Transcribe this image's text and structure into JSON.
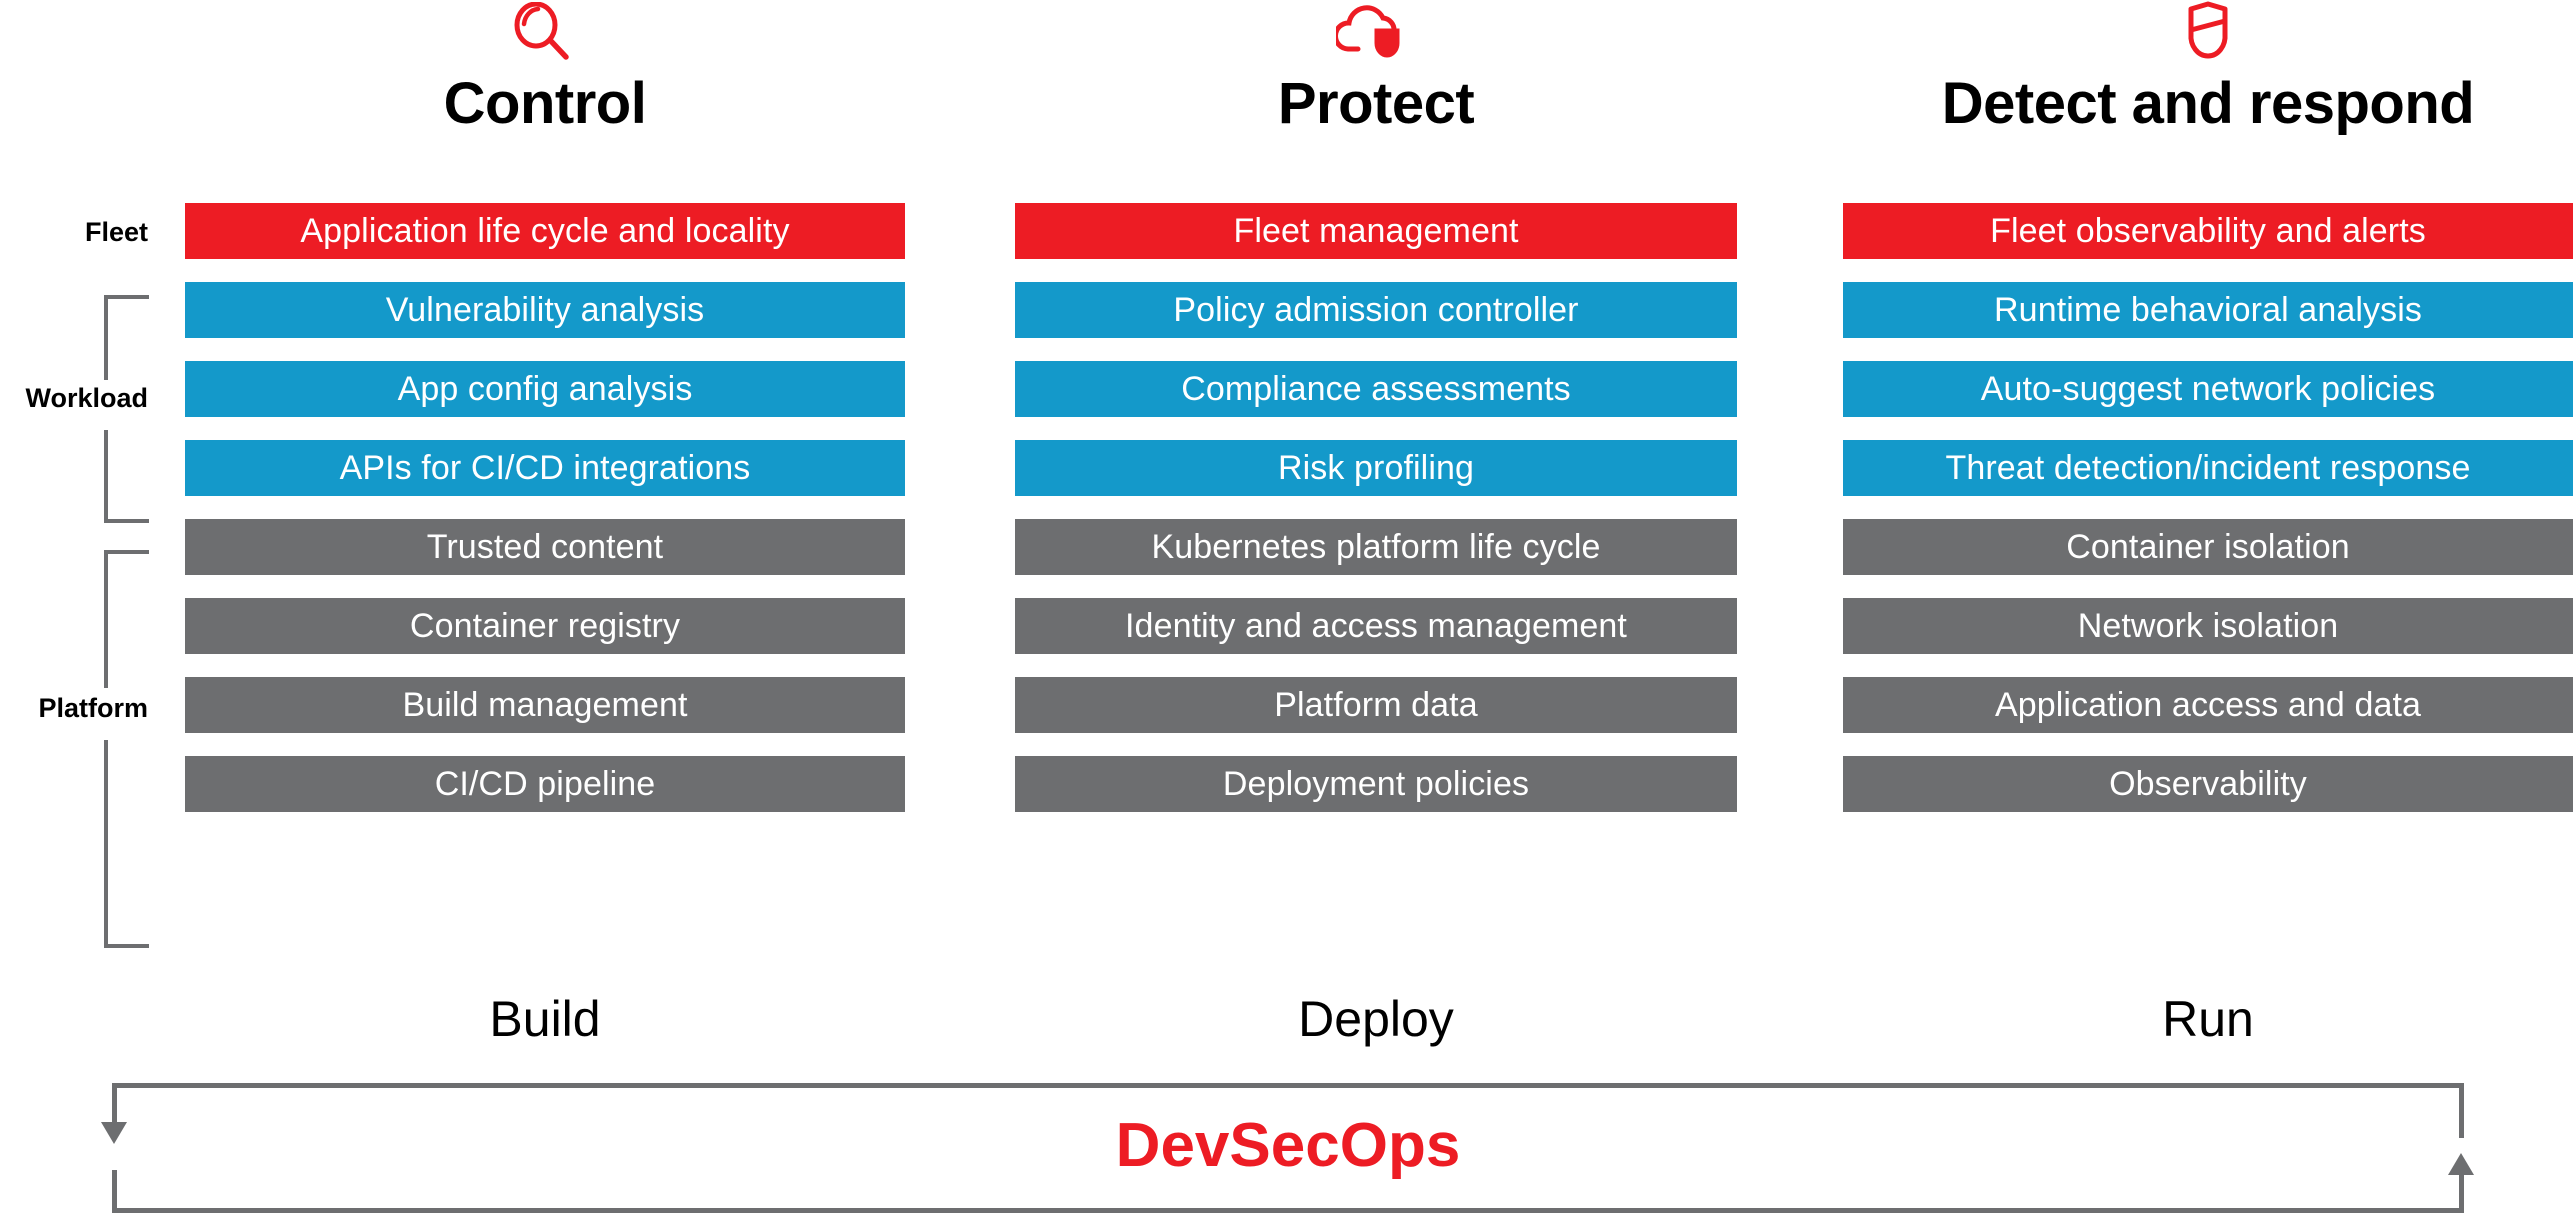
{
  "columns": [
    {
      "title": "Control",
      "icon": "magnifier-icon",
      "stage_label": "Build",
      "rows": [
        {
          "label": "Application life cycle and locality",
          "tier": "fleet"
        },
        {
          "label": "Vulnerability analysis",
          "tier": "workload"
        },
        {
          "label": "App config analysis",
          "tier": "workload"
        },
        {
          "label": "APIs for CI/CD integrations",
          "tier": "workload"
        },
        {
          "label": "Trusted content",
          "tier": "platform"
        },
        {
          "label": "Container registry",
          "tier": "platform"
        },
        {
          "label": "Build management",
          "tier": "platform"
        },
        {
          "label": "CI/CD pipeline",
          "tier": "platform"
        }
      ]
    },
    {
      "title": "Protect",
      "icon": "cloud-shield-icon",
      "stage_label": "Deploy",
      "rows": [
        {
          "label": "Fleet management",
          "tier": "fleet"
        },
        {
          "label": "Policy admission controller",
          "tier": "workload"
        },
        {
          "label": "Compliance assessments",
          "tier": "workload"
        },
        {
          "label": "Risk profiling",
          "tier": "workload"
        },
        {
          "label": "Kubernetes platform life cycle",
          "tier": "platform"
        },
        {
          "label": "Identity and access management",
          "tier": "platform"
        },
        {
          "label": "Platform data",
          "tier": "platform"
        },
        {
          "label": "Deployment policies",
          "tier": "platform"
        }
      ]
    },
    {
      "title": "Detect and respond",
      "icon": "shield-icon",
      "stage_label": "Run",
      "rows": [
        {
          "label": "Fleet observability and alerts",
          "tier": "fleet"
        },
        {
          "label": "Runtime behavioral analysis",
          "tier": "workload"
        },
        {
          "label": "Auto-suggest network policies",
          "tier": "workload"
        },
        {
          "label": "Threat detection/incident response",
          "tier": "workload"
        },
        {
          "label": "Container isolation",
          "tier": "platform"
        },
        {
          "label": "Network isolation",
          "tier": "platform"
        },
        {
          "label": "Application access and data",
          "tier": "platform"
        },
        {
          "label": "Observability",
          "tier": "platform"
        }
      ]
    }
  ],
  "tiers": [
    {
      "key": "fleet",
      "label": "Fleet"
    },
    {
      "key": "workload",
      "label": "Workload"
    },
    {
      "key": "platform",
      "label": "Platform"
    }
  ],
  "footer": {
    "loop_label": "DevSecOps"
  },
  "colors": {
    "fleet": "#ED1C24",
    "workload": "#1499CA",
    "platform": "#6D6E70",
    "accent_red": "#ED1C24",
    "line_gray": "#6D6E70",
    "text_dark": "#000000",
    "bar_text": "#FFFFFF"
  }
}
